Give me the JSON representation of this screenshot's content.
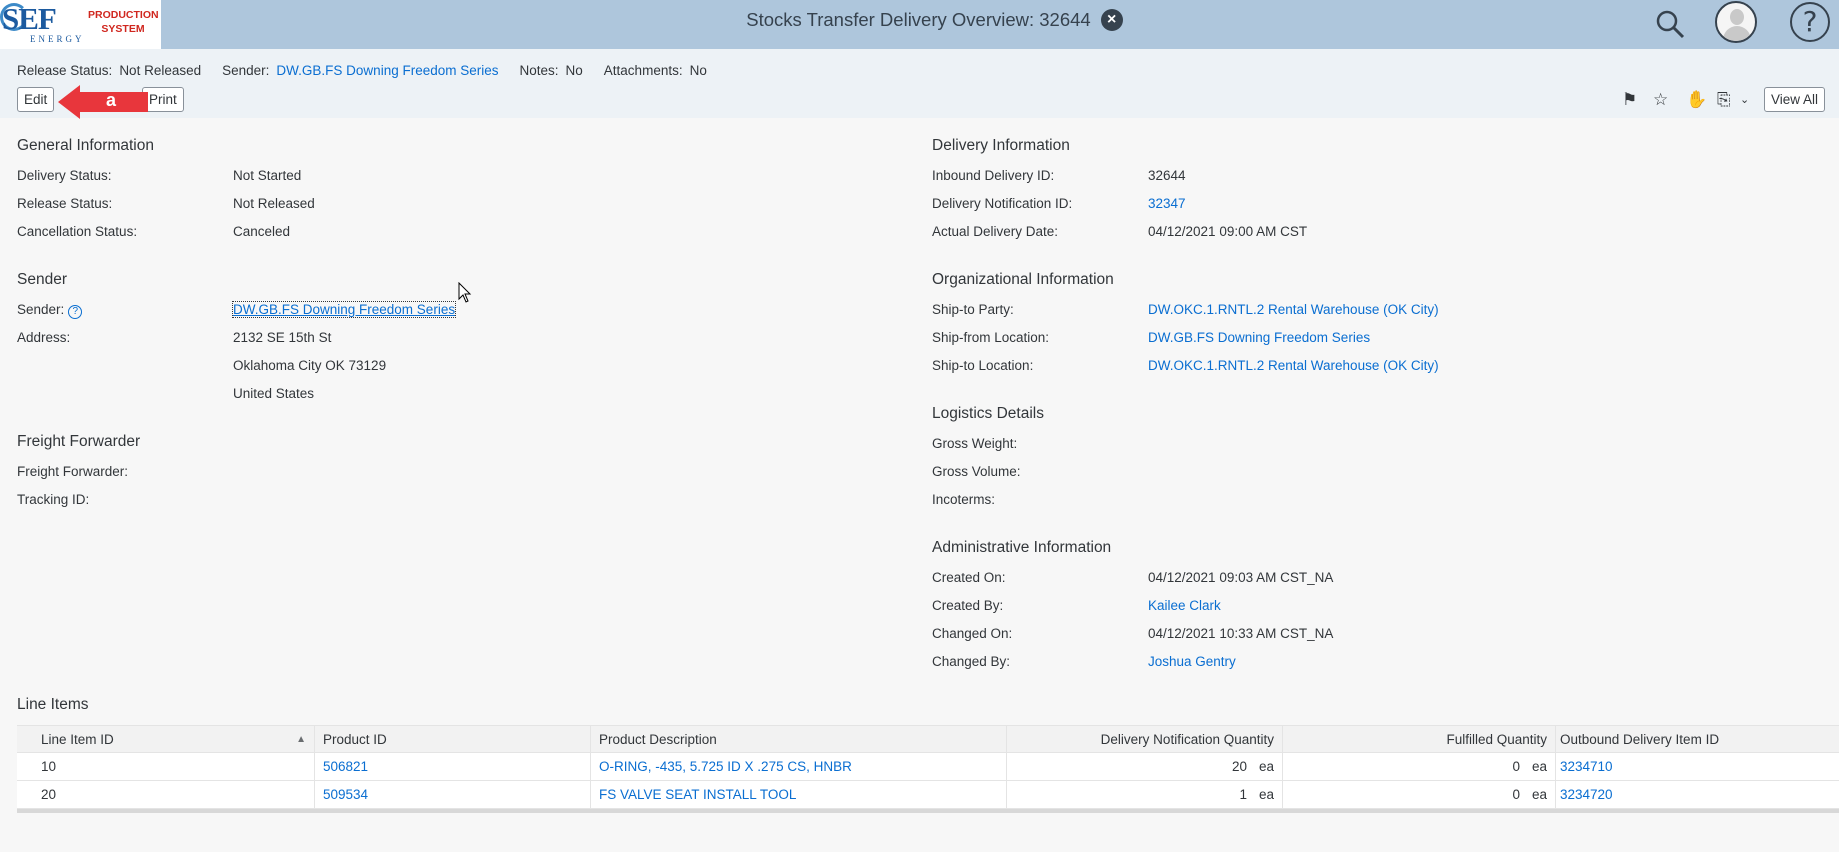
{
  "shell": {
    "logo_text": "SEF",
    "logo_sub": "ENERGY",
    "system_line1": "PRODUCTION",
    "system_line2": "SYSTEM",
    "title": "Stocks Transfer Delivery Overview: 32644"
  },
  "header": {
    "release_status_label": "Release Status:",
    "release_status_value": "Not Released",
    "sender_label": "Sender:",
    "sender_value": "DW.GB.FS Downing Freedom Series",
    "notes_label": "Notes:",
    "notes_value": "No",
    "attachments_label": "Attachments:",
    "attachments_value": "No"
  },
  "toolbar": {
    "edit_label": "Edit",
    "print_label": "Print",
    "view_all_label": "View All",
    "annotation_label": "a"
  },
  "general": {
    "title": "General Information",
    "rows": [
      {
        "label": "Delivery Status:",
        "value": "Not Started"
      },
      {
        "label": "Release Status:",
        "value": "Not Released"
      },
      {
        "label": "Cancellation Status:",
        "value": "Canceled"
      }
    ]
  },
  "sender": {
    "title": "Sender",
    "sender_label": "Sender:",
    "sender_value": "DW.GB.FS Downing Freedom Series",
    "address_label": "Address:",
    "address_lines": [
      "2132 SE 15th St",
      "Oklahoma City OK  73129",
      "United States"
    ]
  },
  "freight": {
    "title": "Freight Forwarder",
    "rows": [
      {
        "label": "Freight Forwarder:",
        "value": ""
      },
      {
        "label": "Tracking ID:",
        "value": ""
      }
    ]
  },
  "delivery": {
    "title": "Delivery Information",
    "rows": [
      {
        "label": "Inbound Delivery ID:",
        "value": "32644"
      },
      {
        "label": "Delivery Notification ID:",
        "value": "32347"
      },
      {
        "label": "Actual Delivery Date:",
        "value": "04/12/2021 09:00 AM CST"
      }
    ]
  },
  "org": {
    "title": "Organizational Information",
    "rows": [
      {
        "label": "Ship-to Party:",
        "value": "DW.OKC.1.RNTL.2 Rental Warehouse (OK City)"
      },
      {
        "label": "Ship-from Location:",
        "value": "DW.GB.FS Downing Freedom Series"
      },
      {
        "label": "Ship-to Location:",
        "value": "DW.OKC.1.RNTL.2 Rental Warehouse (OK City)"
      }
    ]
  },
  "logistics": {
    "title": "Logistics Details",
    "rows": [
      {
        "label": "Gross Weight:",
        "value": ""
      },
      {
        "label": "Gross Volume:",
        "value": ""
      },
      {
        "label": "Incoterms:",
        "value": ""
      }
    ]
  },
  "admin": {
    "title": "Administrative Information",
    "rows": [
      {
        "label": "Created On:",
        "value": "04/12/2021 09:03 AM CST_NA"
      },
      {
        "label": "Created By:",
        "value": "Kailee Clark"
      },
      {
        "label": "Changed On:",
        "value": "04/12/2021 10:33 AM CST_NA"
      },
      {
        "label": "Changed By:",
        "value": "Joshua Gentry"
      }
    ]
  },
  "line_items": {
    "title": "Line Items",
    "columns": [
      "Line Item ID",
      "Product ID",
      "Product Description",
      "Delivery Notification Quantity",
      "Fulfilled Quantity",
      "Outbound Delivery Item ID"
    ],
    "rows": [
      {
        "id": "10",
        "product_id": "506821",
        "description": "O-RING, -435, 5.725 ID X .275 CS, HNBR",
        "notif_qty": "20",
        "notif_unit": "ea",
        "fulfilled_qty": "0",
        "fulfilled_unit": "ea",
        "outbound_id": "3234710"
      },
      {
        "id": "20",
        "product_id": "509534",
        "description": "FS VALVE SEAT INSTALL TOOL",
        "notif_qty": "1",
        "notif_unit": "ea",
        "fulfilled_qty": "0",
        "fulfilled_unit": "ea",
        "outbound_id": "3234720"
      }
    ]
  },
  "colors": {
    "shellbar": "#aec6dc",
    "link": "#0a6ed1",
    "annotation": "#e8363c"
  }
}
